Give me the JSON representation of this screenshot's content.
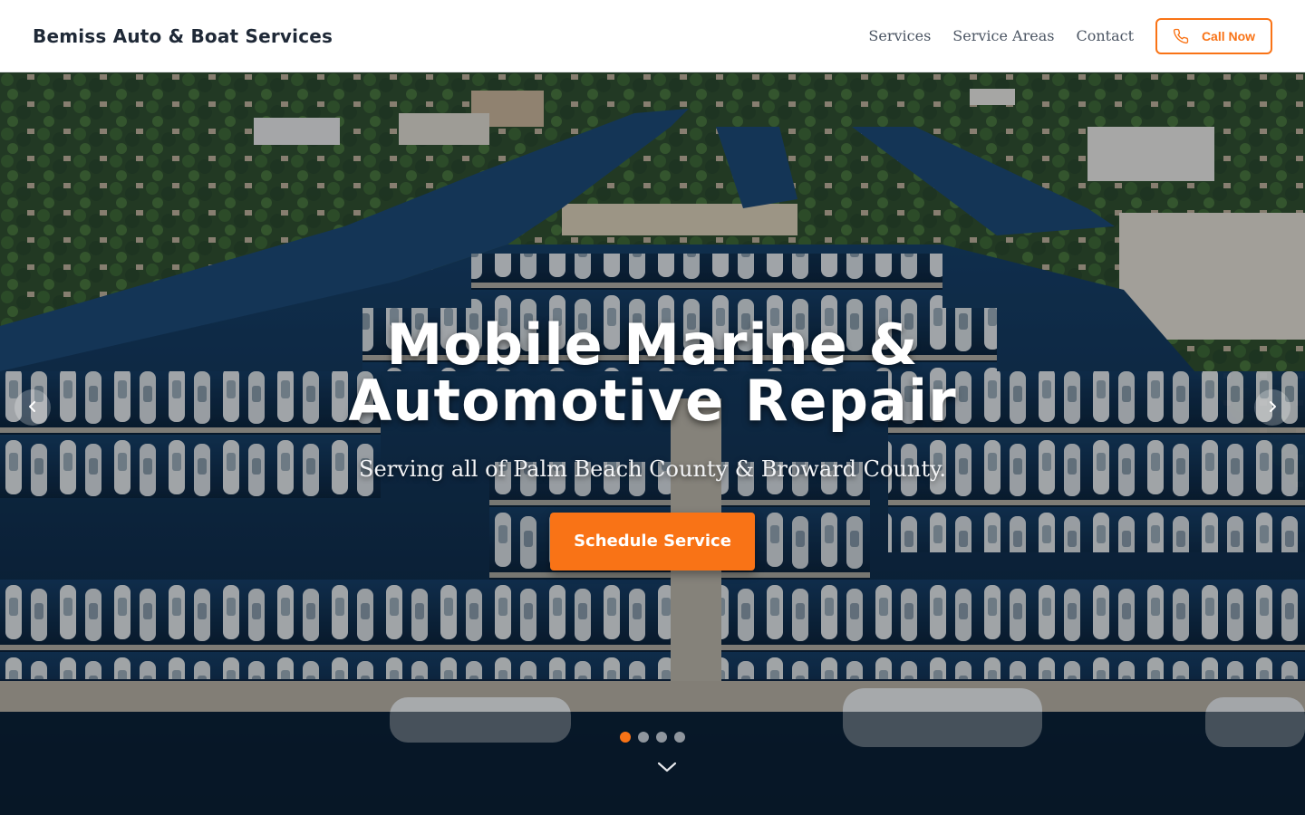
{
  "header": {
    "brand": "Bemiss Auto & Boat Services",
    "nav": [
      "Services",
      "Service Areas",
      "Contact"
    ],
    "call_label": "Call Now",
    "call_icon": "phone-icon"
  },
  "hero": {
    "title_line1": "Mobile Marine &",
    "title_line2": "Automotive Repair",
    "subtitle": "Serving all of Palm Beach County & Broward County.",
    "cta_label": "Schedule Service",
    "prev_icon": "chevron-left-icon",
    "next_icon": "chevron-right-icon",
    "scroll_icon": "chevron-down-icon",
    "slide_count": 4,
    "active_slide": 1
  },
  "colors": {
    "accent": "#f97316",
    "brand_text": "#1f2937",
    "nav_text": "#4b5563",
    "water": "#0f2f4d"
  }
}
